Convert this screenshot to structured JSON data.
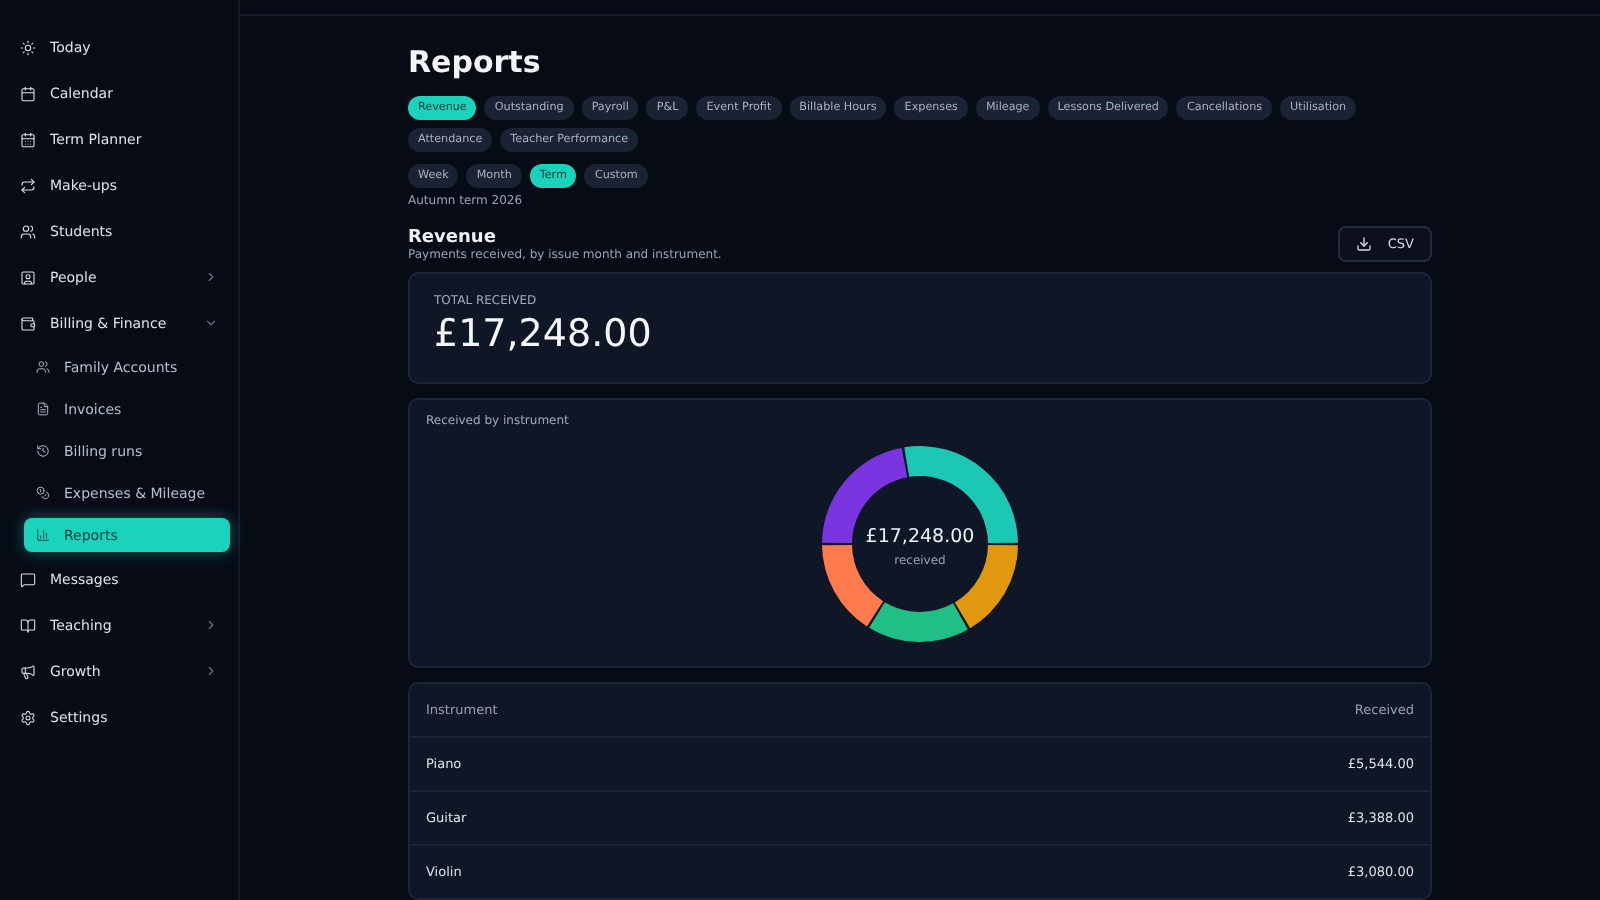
{
  "sidebar": {
    "items": [
      {
        "label": "Today",
        "selected": false
      },
      {
        "label": "Calendar",
        "selected": false
      },
      {
        "label": "Term Planner",
        "selected": false
      },
      {
        "label": "Make-ups",
        "selected": false
      },
      {
        "label": "Students",
        "selected": false
      },
      {
        "label": "People",
        "selected": false,
        "expanded": false
      },
      {
        "label": "Billing & Finance",
        "selected": false,
        "expanded": true,
        "children": [
          {
            "label": "Family Accounts",
            "selected": false
          },
          {
            "label": "Invoices",
            "selected": false
          },
          {
            "label": "Billing runs",
            "selected": false
          },
          {
            "label": "Expenses & Mileage",
            "selected": false
          },
          {
            "label": "Reports",
            "selected": true
          }
        ]
      },
      {
        "label": "Messages",
        "selected": false
      },
      {
        "label": "Teaching",
        "selected": false,
        "expanded": false
      },
      {
        "label": "Growth",
        "selected": false,
        "expanded": false
      },
      {
        "label": "Settings",
        "selected": false
      }
    ]
  },
  "page_title": "Reports",
  "report_tabs": [
    {
      "label": "Revenue",
      "selected": true
    },
    {
      "label": "Outstanding",
      "selected": false
    },
    {
      "label": "Payroll",
      "selected": false
    },
    {
      "label": "P&L",
      "selected": false
    },
    {
      "label": "Event Profit",
      "selected": false
    },
    {
      "label": "Billable Hours",
      "selected": false
    },
    {
      "label": "Expenses",
      "selected": false
    },
    {
      "label": "Mileage",
      "selected": false
    },
    {
      "label": "Lessons Delivered",
      "selected": false
    },
    {
      "label": "Cancellations",
      "selected": false
    },
    {
      "label": "Utilisation",
      "selected": false
    },
    {
      "label": "Attendance",
      "selected": false
    },
    {
      "label": "Teacher Performance",
      "selected": false
    }
  ],
  "period_tabs": [
    {
      "label": "Week",
      "selected": false
    },
    {
      "label": "Month",
      "selected": false
    },
    {
      "label": "Term",
      "selected": true
    },
    {
      "label": "Custom",
      "selected": false
    }
  ],
  "period_label": "Autumn term 2026",
  "section": {
    "title": "Revenue",
    "subtitle": "Payments received, by issue month and instrument.",
    "export_button": "CSV"
  },
  "total_card": {
    "label": "TOTAL RECEIVED",
    "value": "£17,248.00"
  },
  "donut_card": {
    "title": "Received by instrument",
    "center_value": "£17,248.00",
    "center_label": "received"
  },
  "table": {
    "columns": [
      "Instrument",
      "Received"
    ],
    "rows": [
      [
        "Piano",
        "£5,544.00"
      ],
      [
        "Guitar",
        "£3,388.00"
      ],
      [
        "Violin",
        "£3,080.00"
      ]
    ]
  }
}
